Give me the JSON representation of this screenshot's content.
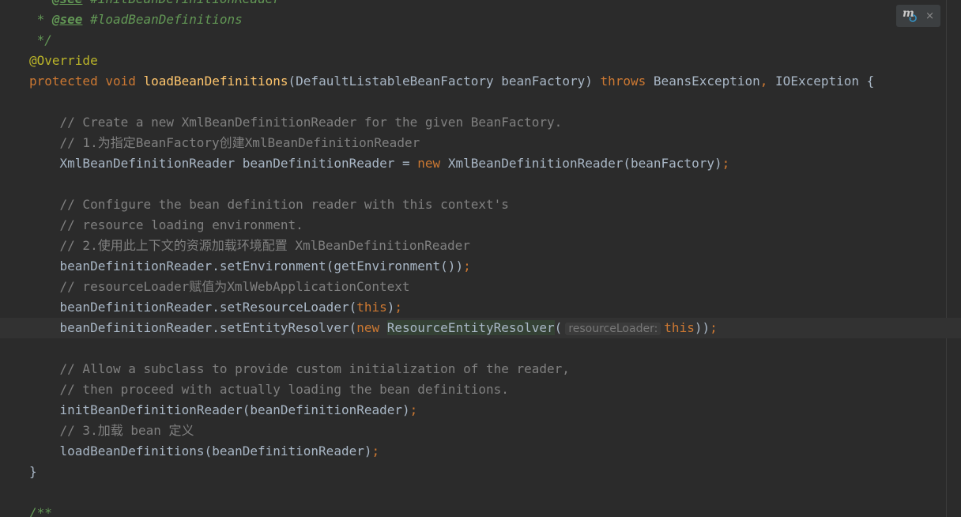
{
  "editor": {
    "language": "Java",
    "theme": "Darcula",
    "colors": {
      "background": "#2b2b2b",
      "keyword": "#cc7832",
      "method_declaration": "#ffc66d",
      "identifier": "#a9b7c6",
      "comment": "#808080",
      "javadoc": "#629755",
      "annotation": "#bbb529",
      "caret_line": "#323232"
    },
    "lines": [
      [
        {
          "t": " * ",
          "c": "c-doc"
        },
        {
          "t": "@see",
          "c": "c-doctag"
        },
        {
          "t": " #initBeanDefinitionReader",
          "c": "c-doc"
        }
      ],
      [
        {
          "t": " * ",
          "c": "c-doc"
        },
        {
          "t": "@see",
          "c": "c-doctag"
        },
        {
          "t": " #loadBeanDefinitions",
          "c": "c-doc"
        }
      ],
      [
        {
          "t": " */",
          "c": "c-doc"
        }
      ],
      [
        {
          "t": "@Override",
          "c": "c-anno"
        }
      ],
      [
        {
          "t": "protected void ",
          "c": "c-kw"
        },
        {
          "t": "loadBeanDefinitions",
          "c": "c-fn"
        },
        {
          "t": "(DefaultListableBeanFactory beanFactory) ",
          "c": "c-id"
        },
        {
          "t": "throws ",
          "c": "c-kw"
        },
        {
          "t": "BeansException",
          "c": "c-id"
        },
        {
          "t": ", ",
          "c": "c-punct"
        },
        {
          "t": "IOException {",
          "c": "c-id"
        }
      ],
      [],
      [
        {
          "t": "    // Create a new XmlBeanDefinitionReader for the given BeanFactory.",
          "c": "c-cmt"
        }
      ],
      [
        {
          "t": "    // 1.为指定BeanFactory创建XmlBeanDefinitionReader",
          "c": "c-cmt"
        }
      ],
      [
        {
          "t": "    XmlBeanDefinitionReader beanDefinitionReader = ",
          "c": "c-id"
        },
        {
          "t": "new ",
          "c": "c-kw"
        },
        {
          "t": "XmlBeanDefinitionReader(beanFactory)",
          "c": "c-id"
        },
        {
          "t": ";",
          "c": "c-punct"
        }
      ],
      [],
      [
        {
          "t": "    // Configure the bean definition reader with this context's",
          "c": "c-cmt"
        }
      ],
      [
        {
          "t": "    // resource loading environment.",
          "c": "c-cmt"
        }
      ],
      [
        {
          "t": "    // 2.使用此上下文的资源加载环境配置 XmlBeanDefinitionReader",
          "c": "c-cmt"
        }
      ],
      [
        {
          "t": "    beanDefinitionReader.setEnvironment(getEnvironment())",
          "c": "c-id"
        },
        {
          "t": ";",
          "c": "c-punct"
        }
      ],
      [
        {
          "t": "    // resourceLoader赋值为XmlWebApplicationContext",
          "c": "c-cmt"
        }
      ],
      [
        {
          "t": "    beanDefinitionReader.setResourceLoader(",
          "c": "c-id"
        },
        {
          "t": "this",
          "c": "c-kw"
        },
        {
          "t": ")",
          "c": "c-id"
        },
        {
          "t": ";",
          "c": "c-punct"
        }
      ],
      [
        {
          "t": "    beanDefinitionReader.setEntityResolver(",
          "c": "c-id"
        },
        {
          "t": "new ",
          "c": "c-kw"
        },
        {
          "t": "ResourceEntityResolver",
          "c": "c-hl"
        },
        {
          "t": "(",
          "c": "c-id"
        },
        {
          "t": "resourceLoader:",
          "c": "c-hint"
        },
        {
          "t": "this",
          "c": "c-kw"
        },
        {
          "t": "))",
          "c": "c-id"
        },
        {
          "t": ";",
          "c": "c-punct"
        }
      ],
      [],
      [
        {
          "t": "    // Allow a subclass to provide custom initialization of the reader,",
          "c": "c-cmt"
        }
      ],
      [
        {
          "t": "    // then proceed with actually loading the bean definitions.",
          "c": "c-cmt"
        }
      ],
      [
        {
          "t": "    initBeanDefinitionReader(beanDefinitionReader)",
          "c": "c-id"
        },
        {
          "t": ";",
          "c": "c-punct"
        }
      ],
      [
        {
          "t": "    // 3.加载 bean 定义",
          "c": "c-cmt"
        }
      ],
      [
        {
          "t": "    loadBeanDefinitions(beanDefinitionReader)",
          "c": "c-id"
        },
        {
          "t": ";",
          "c": "c-punct"
        }
      ],
      [
        {
          "t": "}",
          "c": "c-id"
        }
      ],
      [],
      [
        {
          "t": "/**",
          "c": "c-doc"
        }
      ]
    ]
  },
  "badge": {
    "icon": "maven-reload-icon",
    "icon_letter": "m",
    "close_icon": "close-icon",
    "close_glyph": "×"
  }
}
